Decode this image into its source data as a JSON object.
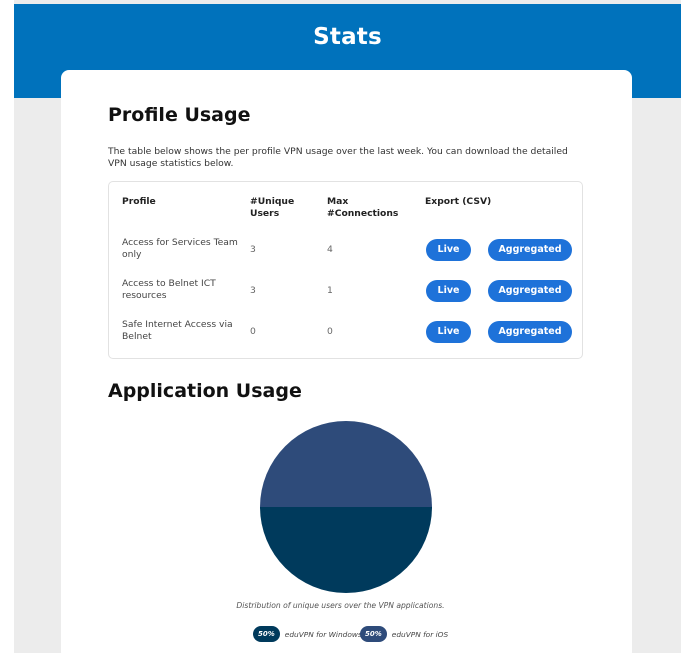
{
  "header": {
    "title": "Stats"
  },
  "profile_usage": {
    "title": "Profile Usage",
    "intro": "The table below shows the per profile VPN usage over the last week. You can download the detailed VPN usage statistics below.",
    "columns": [
      "Profile",
      "#Unique Users",
      "Max #Connections",
      "Export (CSV)"
    ],
    "rows": [
      {
        "profile": "Access for Services Team only",
        "unique_users": "3",
        "max_connections": "4",
        "live_label": "Live",
        "aggregated_label": "Aggregated"
      },
      {
        "profile": "Access to Belnet ICT resources",
        "unique_users": "3",
        "max_connections": "1",
        "live_label": "Live",
        "aggregated_label": "Aggregated"
      },
      {
        "profile": "Safe Internet Access via Belnet",
        "unique_users": "0",
        "max_connections": "0",
        "live_label": "Live",
        "aggregated_label": "Aggregated"
      }
    ]
  },
  "application_usage": {
    "title": "Application Usage",
    "caption": "Distribution of unique users over the VPN applications.",
    "legend": [
      {
        "badge": "50%",
        "label": "eduVPN for Windows",
        "color": "#003a5c"
      },
      {
        "badge": "50%",
        "label": "eduVPN for iOS",
        "color": "#2e4b7a"
      }
    ]
  },
  "chart_data": {
    "type": "pie",
    "title": "",
    "slices": [
      {
        "label": "eduVPN for iOS",
        "value": 50,
        "color": "#2e4b7a"
      },
      {
        "label": "eduVPN for Windows",
        "value": 50,
        "color": "#003a5c"
      }
    ]
  }
}
